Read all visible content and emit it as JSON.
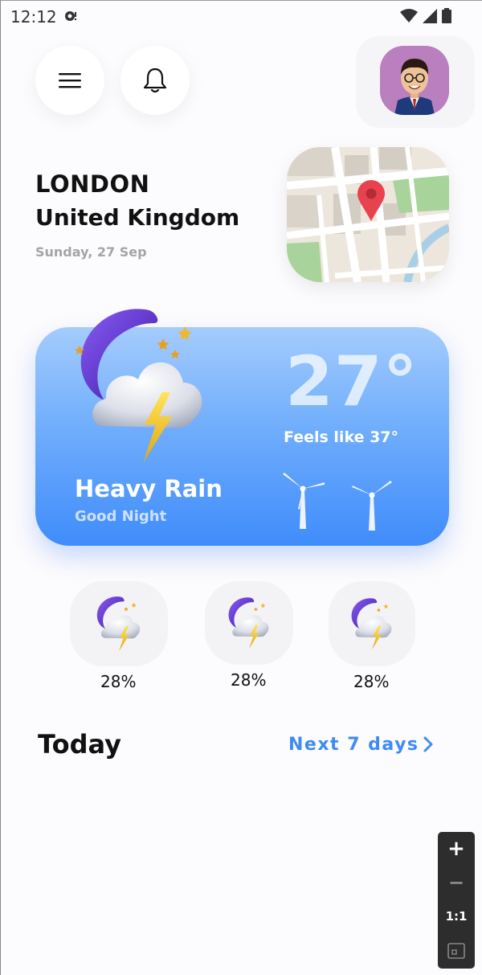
{
  "status_bar": {
    "time": "12:12",
    "icons": [
      "notification-icon",
      "wifi-icon",
      "signal-icon",
      "battery-icon"
    ]
  },
  "header": {
    "menu_icon": "hamburger-menu-icon",
    "bell_icon": "bell-icon",
    "avatar": "user-avatar"
  },
  "location": {
    "city": "LONDON",
    "country": "United Kingdom",
    "date": "Sunday, 27 Sep",
    "map_icon": "map-pin-icon"
  },
  "current": {
    "temperature": "27°",
    "feels_like": "Feels like 37°",
    "condition": "Heavy Rain",
    "greeting": "Good Night",
    "icon": "moon-thunderstorm-icon",
    "wind_icon": "wind-turbine-icon"
  },
  "hourly": [
    {
      "icon": "moon-thunderstorm-icon",
      "percent": "28%"
    },
    {
      "icon": "moon-thunderstorm-icon",
      "percent": "28%"
    },
    {
      "icon": "moon-thunderstorm-icon",
      "percent": "28%"
    }
  ],
  "today_section": {
    "title": "Today",
    "next_link": "Next 7 days"
  },
  "zoom_controls": {
    "zoom_in": "+",
    "zoom_out": "−",
    "actual_size": "1:1"
  },
  "colors": {
    "accent": "#3f8cf0",
    "card_top": "#a4ccfd",
    "card_bottom": "#3f8cfb",
    "avatar_bg": "#b97fbe",
    "map_pin": "#e8424f"
  }
}
